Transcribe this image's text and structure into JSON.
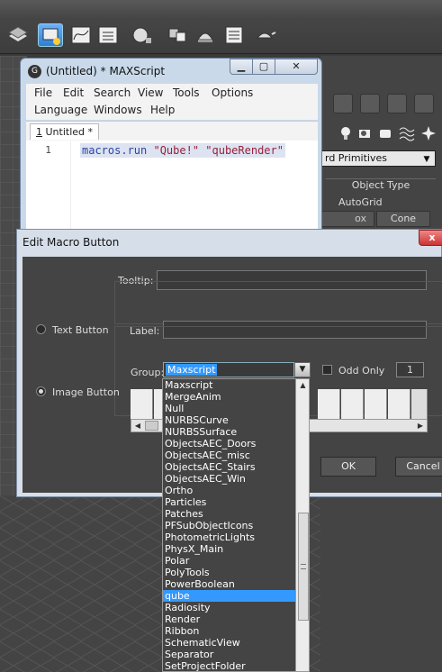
{
  "maxscript_window": {
    "title": "(Untitled) * MAXScript",
    "logo_letter": "G",
    "menu_row1": [
      "File",
      "Edit",
      "Search",
      "View",
      "Tools",
      "Options"
    ],
    "menu_row2": [
      "Language",
      "Windows",
      "Help"
    ],
    "tab_number": "1",
    "tab_label": " Untitled *",
    "line_number": "1",
    "code_fn": "macros.run",
    "code_args": " \"Qube!\" \"qubeRender\""
  },
  "command_panel": {
    "category_value": "rd Primitives",
    "object_type_label": "Object Type",
    "autogrid_label": "AutoGrid",
    "box_button": "ox",
    "cone_button": "Cone"
  },
  "dialog": {
    "title": "Edit Macro Button",
    "close_symbol": "x",
    "tooltip_label": "Tooltip:",
    "tooltip_value": "",
    "text_button_label": "Text Button",
    "label_label": "Label:",
    "label_value": "",
    "image_button_label": "Image Button",
    "group_label": "Group:",
    "group_value": "Maxscript",
    "odd_only_label": "Odd Only",
    "odd_only_checked": false,
    "odd_only_number": "1",
    "selected_button": "image",
    "ok_label": "OK",
    "cancel_label": "Cancel"
  },
  "group_dropdown": {
    "items": [
      "Maxscript",
      "MergeAnim",
      "Null",
      "NURBSCurve",
      "NURBSSurface",
      "ObjectsAEC_Doors",
      "ObjectsAEC_misc",
      "ObjectsAEC_Stairs",
      "ObjectsAEC_Win",
      "Ortho",
      "Particles",
      "Patches",
      "PFSubObjectIcons",
      "PhotometricLights",
      "PhysX_Main",
      "Polar",
      "PolyTools",
      "PowerBoolean",
      "qube",
      "Radiosity",
      "Render",
      "Ribbon",
      "SchematicView",
      "Separator",
      "SetProjectFolder"
    ],
    "selected": "qube",
    "selected_index": 18
  },
  "colors": {
    "selection_blue": "#3399ff",
    "dialog_frame": "#d6dfe9",
    "dark_bg": "#444444"
  }
}
